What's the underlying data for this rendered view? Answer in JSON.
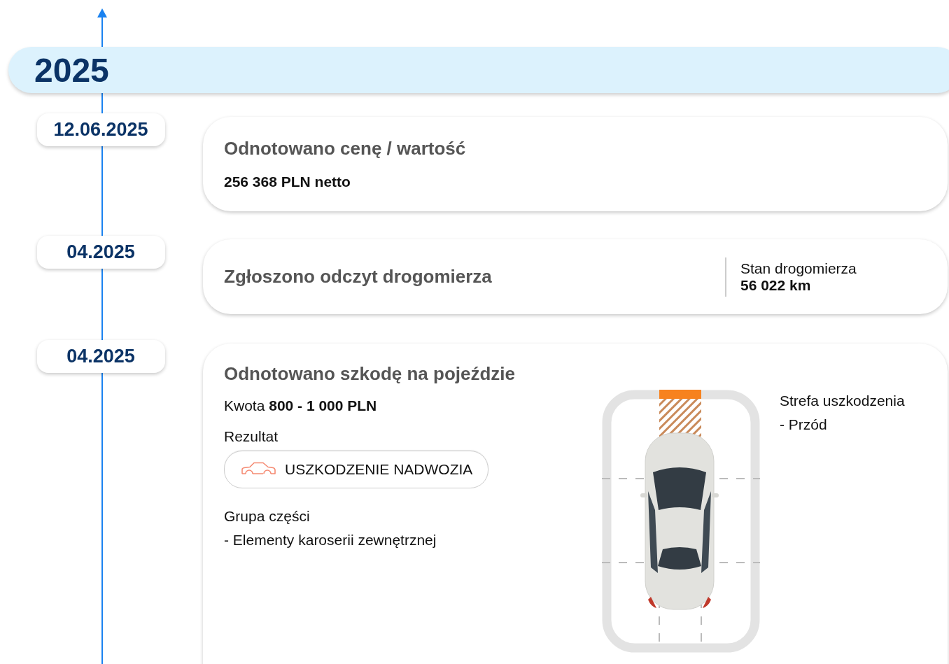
{
  "year": "2025",
  "events": [
    {
      "kind": "price",
      "date": "12.06.2025",
      "title": "Odnotowano cenę / wartość",
      "value": "256 368 PLN netto"
    },
    {
      "kind": "odometer",
      "date": "04.2025",
      "title": "Zgłoszono odczyt drogomierza",
      "reading_label": "Stan drogomierza",
      "reading": "56 022 km"
    },
    {
      "kind": "damage",
      "date": "04.2025",
      "title": "Odnotowano szkodę na pojeździe",
      "amount_label": "Kwota",
      "amount": "800 - 1 000 PLN",
      "result_label": "Rezultat",
      "result": "USZKODZENIE NADWOZIA",
      "parts_label": "Grupa części",
      "parts": [
        "- Elementy karoserii zewnętrznej"
      ],
      "zone_label": "Strefa uszkodzenia",
      "zones": [
        "- Przód"
      ]
    }
  ]
}
